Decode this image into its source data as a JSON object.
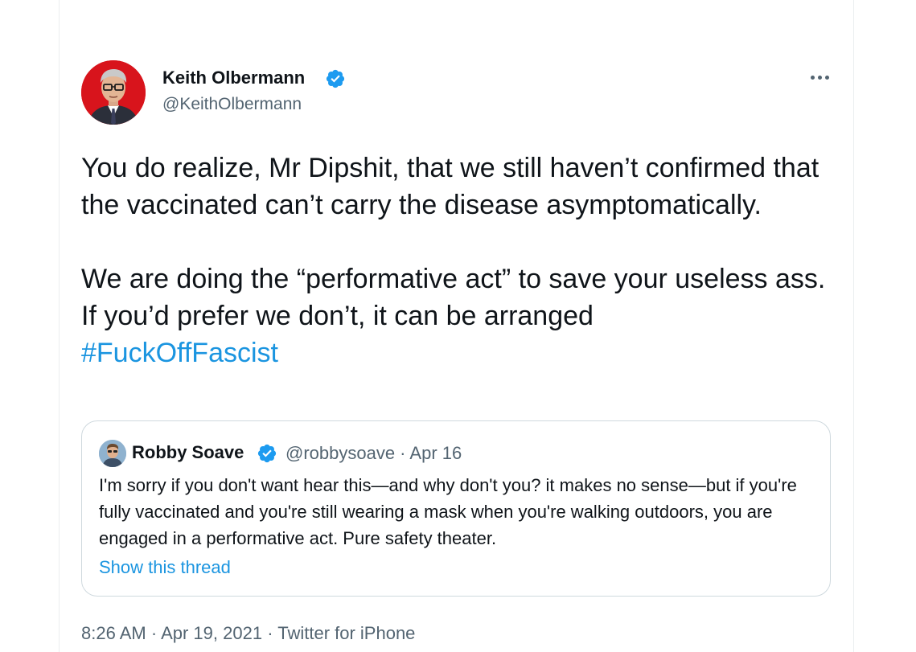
{
  "tweet": {
    "author": {
      "name": "Keith Olbermann",
      "handle": "@KeithOlbermann"
    },
    "text_paragraph_1": "You do realize, Mr Dipshit, that we still haven’t confirmed that the vaccinated can’t carry the disease asymptomatically.",
    "text_paragraph_2": "We are doing the “performative act” to save your useless ass. If you’d prefer we don’t, it can be arranged",
    "hashtag": "#FuckOffFascist",
    "timestamp": {
      "time": "8:26 AM",
      "separator": "·",
      "date": "Apr 19, 2021",
      "source": "Twitter for iPhone"
    }
  },
  "quoted_tweet": {
    "author_name": "Robby Soave",
    "meta": "@robbysoave · Apr 16",
    "text": "I'm sorry if you don't want hear this—and why don't you? it makes no sense—but if you're fully vaccinated and you're still wearing a mask when you're walking outdoors, you are engaged in a performative act. Pure safety theater.",
    "show_thread_label": "Show this thread"
  },
  "icons": {
    "verified": "verified-badge-icon",
    "more": "more-options-icon"
  },
  "colors": {
    "link_blue": "#1b95e0",
    "verified_blue": "#1d9bf0",
    "text_primary": "#0f1419",
    "text_secondary": "#536471",
    "avatar_background": "#d8141c"
  }
}
